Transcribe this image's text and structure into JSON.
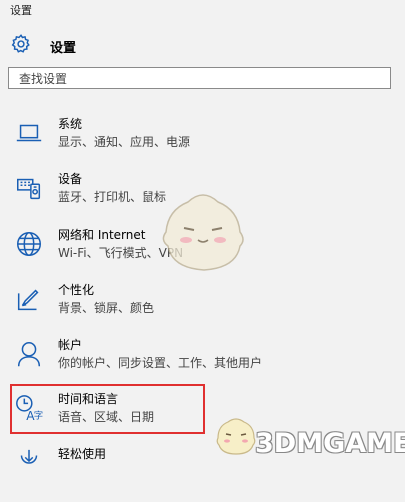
{
  "window_title": "设置",
  "header": {
    "title": "设置",
    "icon": "gear-icon"
  },
  "search": {
    "placeholder": "查找设置"
  },
  "items": [
    {
      "name": "系统",
      "desc": "显示、通知、应用、电源",
      "icon": "laptop-icon"
    },
    {
      "name": "设备",
      "desc": "蓝牙、打印机、鼠标",
      "icon": "devices-icon"
    },
    {
      "name": "网络和 Internet",
      "desc": "Wi-Fi、飞行模式、VPN",
      "icon": "globe-icon"
    },
    {
      "name": "个性化",
      "desc": "背景、锁屏、颜色",
      "icon": "personalization-icon"
    },
    {
      "name": "帐户",
      "desc": "你的帐户、同步设置、工作、其他用户",
      "icon": "person-icon"
    },
    {
      "name": "时间和语言",
      "desc": "语音、区域、日期",
      "icon": "time-language-icon"
    },
    {
      "name": "轻松使用",
      "desc": "",
      "icon": "ease-of-access-icon"
    }
  ],
  "highlight_color": "#e03030",
  "watermark": "3DMGAME"
}
